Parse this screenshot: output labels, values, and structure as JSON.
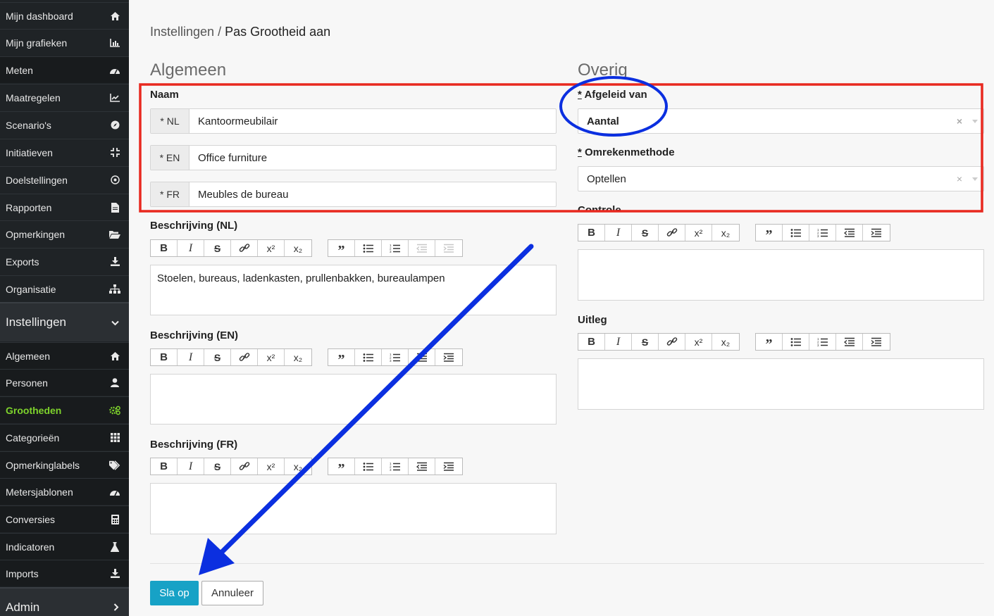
{
  "sidebar": {
    "top_items": [
      {
        "label": "Mijn dashboard",
        "icon": "home-icon"
      },
      {
        "label": "Mijn grafieken",
        "icon": "bar-chart-icon"
      },
      {
        "label": "Meten",
        "icon": "gauge-icon"
      },
      {
        "label": "Maatregelen",
        "icon": "line-chart-icon"
      },
      {
        "label": "Scenario's",
        "icon": "compass-icon"
      },
      {
        "label": "Initiatieven",
        "icon": "compress-icon"
      },
      {
        "label": "Doelstellingen",
        "icon": "target-icon"
      },
      {
        "label": "Rapporten",
        "icon": "file-icon"
      },
      {
        "label": "Opmerkingen",
        "icon": "folder-open-icon"
      },
      {
        "label": "Exports",
        "icon": "download-icon"
      },
      {
        "label": "Organisatie",
        "icon": "sitemap-icon"
      }
    ],
    "settings_section": "Instellingen",
    "settings_items": [
      {
        "label": "Algemeen",
        "icon": "home-icon"
      },
      {
        "label": "Personen",
        "icon": "user-icon"
      },
      {
        "label": "Grootheden",
        "icon": "cogs-icon",
        "active": true
      },
      {
        "label": "Categorieën",
        "icon": "grid-icon"
      },
      {
        "label": "Opmerkinglabels",
        "icon": "tags-icon"
      },
      {
        "label": "Metersjablonen",
        "icon": "gauge-icon"
      },
      {
        "label": "Conversies",
        "icon": "calculator-icon"
      },
      {
        "label": "Indicatoren",
        "icon": "flask-icon"
      },
      {
        "label": "Imports",
        "icon": "download-icon"
      }
    ],
    "admin_section": "Admin"
  },
  "breadcrumb": {
    "parent": "Instellingen",
    "separator": " / ",
    "current": "Pas Grootheid aan"
  },
  "algemeen": {
    "heading": "Algemeen",
    "naam_label": "Naam",
    "names": [
      {
        "lang": "* NL",
        "value": "Kantoormeubilair"
      },
      {
        "lang": "* EN",
        "value": "Office furniture"
      },
      {
        "lang": "* FR",
        "value": "Meubles de bureau"
      }
    ],
    "desc_nl_label": "Beschrijving (NL)",
    "desc_nl_value": "Stoelen, bureaus, ladenkasten, prullenbakken, bureaulampen",
    "desc_en_label": "Beschrijving (EN)",
    "desc_en_value": "",
    "desc_fr_label": "Beschrijving (FR)",
    "desc_fr_value": ""
  },
  "overig": {
    "heading": "Overig",
    "afgeleid_req": "*",
    "afgeleid_label": " Afgeleid van",
    "afgeleid_value": "Aantal",
    "omrekening_req": "*",
    "omrekening_label": " Omrekenmethode",
    "omrekening_value": "Optellen",
    "controle_label": "Controle",
    "controle_value": "",
    "uitleg_label": "Uitleg",
    "uitleg_value": ""
  },
  "toolbar_icons": [
    "bold-icon",
    "italic-icon",
    "strikethrough-icon",
    "link-icon",
    "superscript-icon",
    "subscript-icon",
    "blockquote-icon",
    "bullet-list-icon",
    "numbered-list-icon",
    "outdent-icon",
    "indent-icon"
  ],
  "toolbar_glyphs": {
    "bold": "B",
    "italic": "I",
    "strike": "S",
    "sup": "x²",
    "sub": "x₂"
  },
  "buttons": {
    "save": "Sla op",
    "cancel": "Annuleer"
  },
  "colors": {
    "sidebar_bg": "#1f2326",
    "active_green": "#7ed32c",
    "primary": "#17a2c6",
    "annotation_red": "#e8281f",
    "annotation_blue": "#0b2fe0"
  }
}
